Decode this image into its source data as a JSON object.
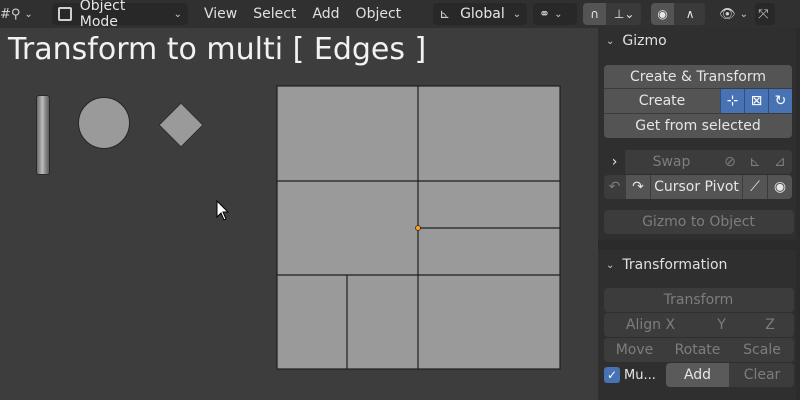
{
  "header": {
    "mode": "Object Mode",
    "menus": [
      "View",
      "Select",
      "Add",
      "Object"
    ],
    "orientation": "Global"
  },
  "viewport": {
    "title": "Transform to multi [ Edges ]"
  },
  "gizmo": {
    "heading": "Gizmo",
    "create_transform": "Create & Transform",
    "create": "Create",
    "get_from_selected": "Get from selected",
    "swap": "Swap",
    "cursor_pivot": "Cursor Pivot",
    "gizmo_to_object": "Gizmo to Object"
  },
  "transformation": {
    "heading": "Transformation",
    "transform": "Transform",
    "align_x": "Align X",
    "y": "Y",
    "z": "Z",
    "move": "Move",
    "rotate": "Rotate",
    "scale": "Scale",
    "multi_label": "Mu...",
    "add": "Add",
    "clear": "Clear"
  },
  "colors": {
    "accent": "#4772b3",
    "background": "#3d3d3d",
    "panel": "#2f2f2f",
    "mesh_face": "#9a9a9a",
    "pivot": "#ff9f2a"
  }
}
